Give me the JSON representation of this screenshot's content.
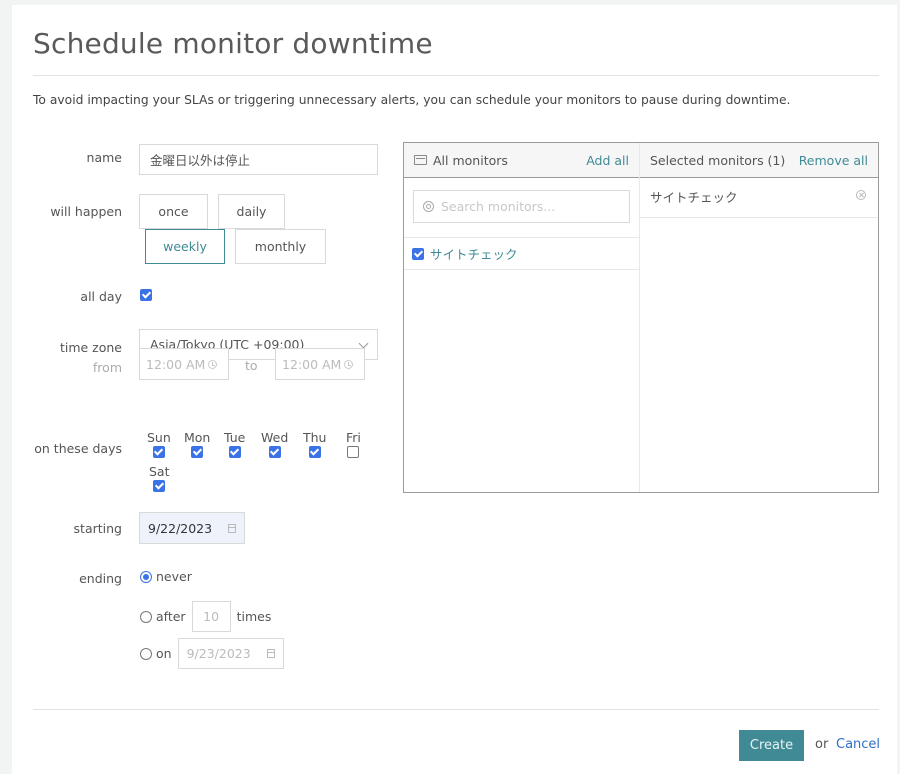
{
  "title": "Schedule monitor downtime",
  "intro": "To avoid impacting your SLAs or triggering unnecessary alerts, you can schedule your monitors to pause during downtime.",
  "form": {
    "name": {
      "label": "name",
      "value": "金曜日以外は停止"
    },
    "frequency": {
      "label": "will happen",
      "options": [
        "once",
        "daily",
        "weekly",
        "monthly"
      ],
      "selected": "weekly"
    },
    "all_day": {
      "label": "all day",
      "checked": true
    },
    "time_zone": {
      "label": "time zone",
      "value": "Asia/Tokyo (UTC +09:00)"
    },
    "time_range": {
      "from_label": "from",
      "from_value": "12:00 AM",
      "to_label": "to",
      "to_value": "12:00 AM"
    },
    "days": {
      "label": "on these days",
      "items": [
        {
          "label": "Sun",
          "checked": true
        },
        {
          "label": "Mon",
          "checked": true
        },
        {
          "label": "Tue",
          "checked": true
        },
        {
          "label": "Wed",
          "checked": true
        },
        {
          "label": "Thu",
          "checked": true
        },
        {
          "label": "Fri",
          "checked": false
        },
        {
          "label": "Sat",
          "checked": true
        }
      ]
    },
    "starting": {
      "label": "starting",
      "value": "9/22/2023"
    },
    "ending": {
      "label": "ending",
      "selected": "never",
      "never_label": "never",
      "after_label": "after",
      "after_value": "10",
      "times_label": "times",
      "on_label": "on",
      "on_value": "9/23/2023"
    }
  },
  "monitors": {
    "all_header": "All monitors",
    "add_all": "Add all",
    "selected_header": "Selected monitors (1)",
    "remove_all": "Remove all",
    "search_placeholder": "Search monitors...",
    "available": [
      {
        "name": "サイトチェック",
        "checked": true
      }
    ],
    "selected": [
      {
        "name": "サイトチェック"
      }
    ]
  },
  "footer": {
    "create": "Create",
    "or": "or",
    "cancel": "Cancel"
  },
  "colors": {
    "accent": "#3f8a95",
    "checkbox": "#3b72e6",
    "link": "#2f6fc6"
  }
}
